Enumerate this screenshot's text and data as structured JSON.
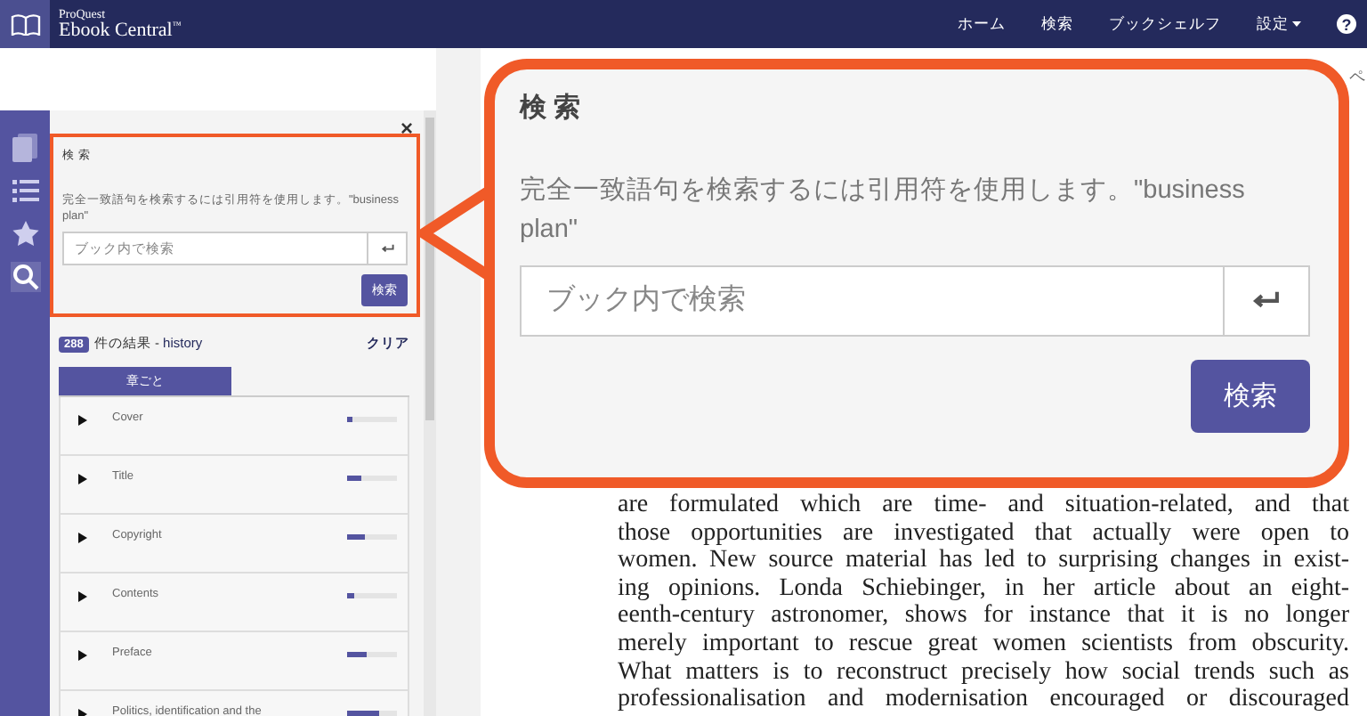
{
  "navbar": {
    "brand_small": "ProQuest",
    "brand": "Ebook Central",
    "brand_mark": "™",
    "links": [
      {
        "label": "ホーム"
      },
      {
        "label": "検索"
      },
      {
        "label": "ブックシェルフ"
      },
      {
        "label": "設定"
      }
    ],
    "help": "?"
  },
  "rail": [
    {
      "selected": false
    },
    {
      "selected": false
    },
    {
      "selected": false
    },
    {
      "selected": true
    }
  ],
  "panel": {
    "close": "×",
    "search": {
      "title": "検 索",
      "hint": "完全一致語句を検索するには引用符を使用します。\"business plan\"",
      "placeholder": "ブック内で検索",
      "button": "検索"
    },
    "results": {
      "count": "288",
      "label": "件の結果 - ",
      "query": "history",
      "clear": "クリア"
    },
    "tabs": [
      {
        "label": "章ごと",
        "selected": true
      }
    ],
    "chapters": [
      {
        "title": "Cover",
        "level": 0.1
      },
      {
        "title": "Title",
        "level": 0.28
      },
      {
        "title": "Copyright",
        "level": 0.35
      },
      {
        "title": "Contents",
        "level": 0.15
      },
      {
        "title": "Preface",
        "level": 0.4
      },
      {
        "title": "Politics, identification and the",
        "level": 0.65
      }
    ]
  },
  "document": {
    "page_label": "ペ",
    "lines": [
      "are formulated which are time- and situation-related, and that",
      "those opportunities are investigated that actually were open to",
      "women. New source material has led to surprising changes in exist-",
      "ing opinions. Londa Schiebinger, in her article about an eight-",
      "eenth-century astronomer, shows for instance that it is no longer",
      "merely important to rescue great women scientists from obscurity.",
      "What matters is to reconstruct precisely how social trends such as",
      "professionalisation and modernisation encouraged or discouraged"
    ]
  },
  "callout": {
    "title": "検 索",
    "hint": "完全一致語句を検索するには引用符を使用します。\"business plan\"",
    "placeholder": "ブック内で検索",
    "button": "検索"
  }
}
